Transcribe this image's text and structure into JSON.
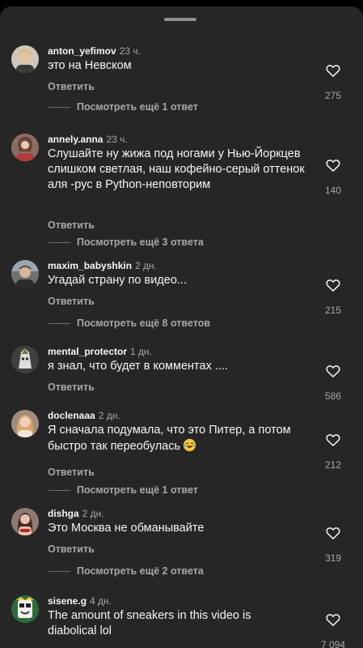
{
  "reply_label": "Ответить",
  "comments": [
    {
      "username": "anton_yefimov",
      "time": "23 ч.",
      "text": "это на Невском",
      "likes": "275",
      "more": "Посмотреть ещё 1 ответ"
    },
    {
      "username": "annely.anna",
      "time": "23 ч.",
      "text": "Слушайте ну жижа под ногами у Нью-Йоркцев слишком светлая, наш  кофейно-серый оттенок аля -рус в Python-неповторим",
      "likes": "140",
      "more": "Посмотреть ещё 3 ответа"
    },
    {
      "username": "maxim_babyshkin",
      "time": "2 дн.",
      "text": "Угадай страну по видео...",
      "likes": "215",
      "more": "Посмотреть ещё 8 ответов"
    },
    {
      "username": "mental_protector",
      "time": "1 дн.",
      "text": "я знал, что будет в комментах ....",
      "likes": "586",
      "more": ""
    },
    {
      "username": "doclenaaa",
      "time": "2 дн.",
      "text": "Я сначала подумала, что это Питер, а потом быстро так переобулась",
      "likes": "212",
      "more": "Посмотреть ещё 1 ответ"
    },
    {
      "username": "dishga",
      "time": "2 дн.",
      "text": "Это Москва не обманывайте",
      "likes": "319",
      "more": "Посмотреть ещё 2 ответа"
    },
    {
      "username": "sisene.g",
      "time": "4 дн.",
      "text": "The amount of sneakers in this video is diabolical lol",
      "likes": "7 094",
      "more": ""
    }
  ],
  "colors": {
    "sheet_bg": "#262626",
    "text": "#f5f5f5",
    "secondary": "#a8a8a8"
  },
  "icons": {
    "like": "heart-outline-icon",
    "emoji": "laughing-tears-emoji"
  }
}
